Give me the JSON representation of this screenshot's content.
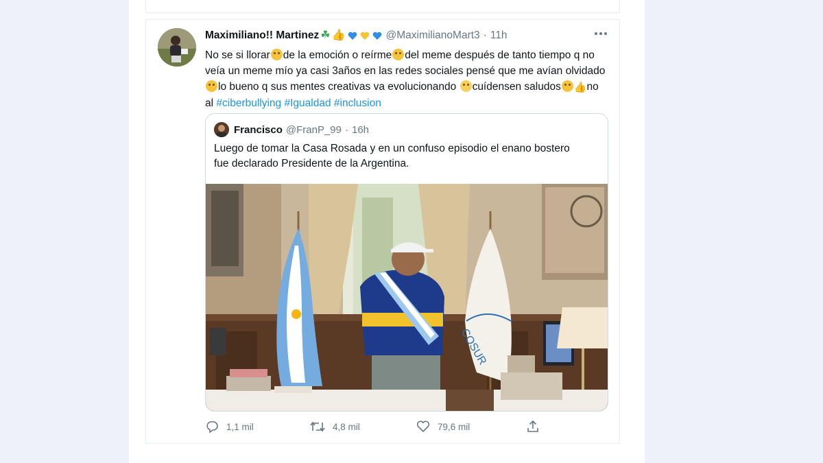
{
  "tweet": {
    "author_name": "Maximiliano!! Martinez",
    "name_emoji": [
      "☘",
      "👍"
    ],
    "handle": "@MaximilianoMart3",
    "separator": "·",
    "time": "11h",
    "text_parts": {
      "t1": "No se si llorar",
      "t2": "de la emoción o reírme",
      "t3": "del meme después de tanto tiempo q no veía un meme mío ya casi 3años en las redes sociales pensé que me avían olvidado",
      "t4": "lo bueno q sus mentes creativas va evolucionando",
      "t5": "cuídensen saludos",
      "t6": "no al"
    },
    "hashtags": [
      "#ciberbullying",
      "#Igualdad",
      "#inclusion"
    ],
    "heart_colors": [
      "#2f8fe0",
      "#f4c430",
      "#2f8fe0"
    ],
    "clap_icon": "clapping-hands-icon"
  },
  "quoted": {
    "author_name": "Francisco",
    "handle": "@FranP_99",
    "separator": "·",
    "time": "16h",
    "text": "Luego de tomar la Casa Rosada y en un confuso episodio el enano bostero fue declarado Presidente de la Argentina.",
    "image_flag_text": "COSUR"
  },
  "actions": {
    "reply_count": "1,1 mil",
    "retweet_count": "4,8 mil",
    "like_count": "79,6 mil"
  },
  "colors": {
    "link": "#1b95e0",
    "muted": "#657786",
    "border": "#e6ecf0",
    "background": "#eef1f8"
  }
}
